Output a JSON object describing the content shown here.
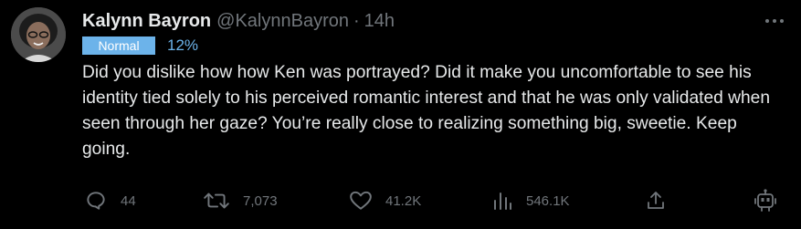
{
  "author": {
    "name": "Kalynn Bayron",
    "handle": "@KalynnBayron",
    "separator": "·",
    "time": "14h"
  },
  "label": {
    "badge": "Normal",
    "percent": "12%"
  },
  "tweet_text": "Did you dislike how how Ken was portrayed? Did it make you uncomfortable to see his identity tied solely to his perceived romantic interest and that he was only validated when seen through her gaze? You’re really close to realizing something big, sweetie. Keep going.",
  "actions": {
    "replies": "44",
    "retweets": "7,073",
    "likes": "41.2K",
    "views": "546.1K"
  },
  "icons": {
    "more": "more-dots-icon",
    "reply": "reply-icon",
    "retweet": "retweet-icon",
    "like": "heart-icon",
    "views": "views-bar-icon",
    "share": "share-icon",
    "grok": "grok-bot-icon"
  },
  "colors": {
    "background": "#000000",
    "text": "#e7e9ea",
    "muted": "#71767b",
    "badge": "#6cb3ea"
  }
}
